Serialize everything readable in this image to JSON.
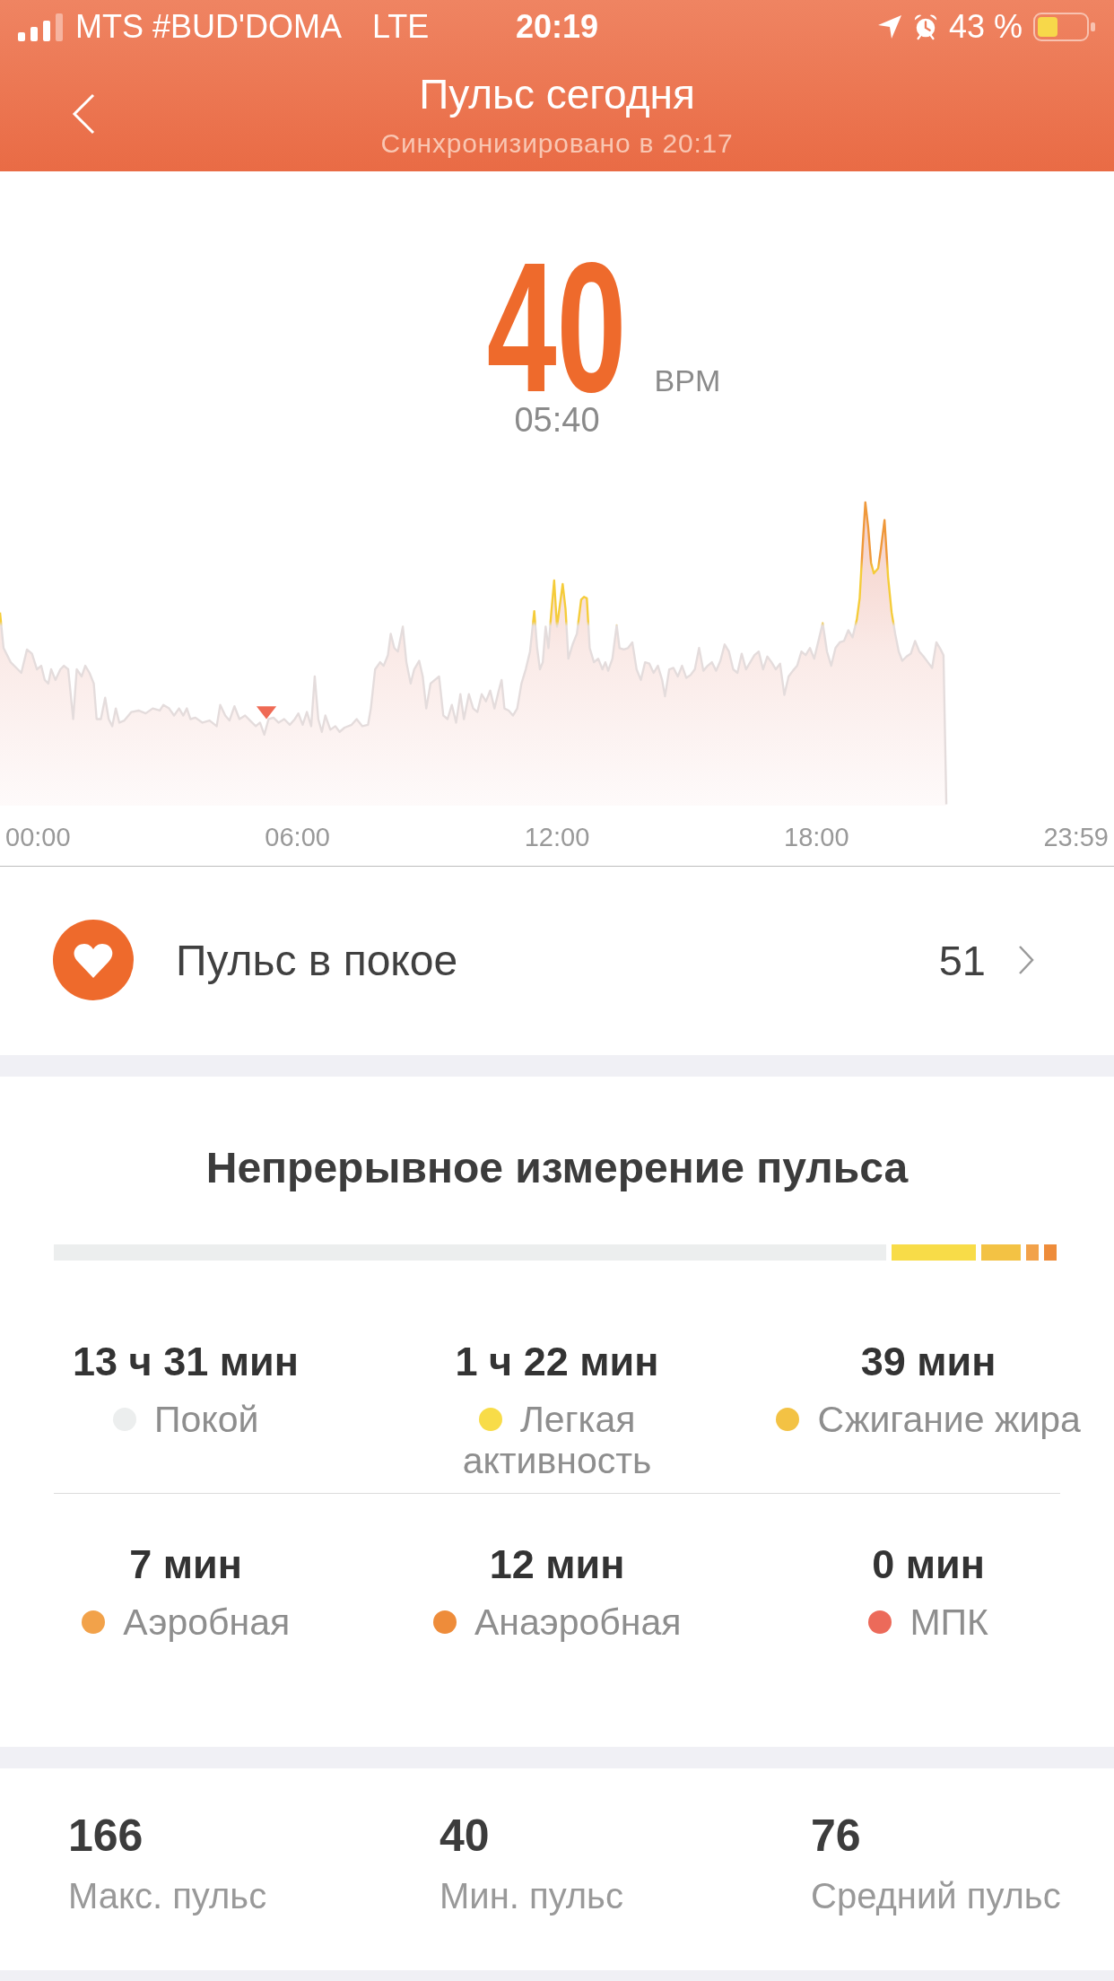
{
  "status_bar": {
    "carrier": "MTS #BUD'DOMA",
    "network": "LTE",
    "time": "20:19",
    "battery": "43 %"
  },
  "header": {
    "title": "Пульс сегодня",
    "subtitle": "Синхронизировано в 20:17"
  },
  "reading": {
    "value": "40",
    "unit": "BPM",
    "time": "05:40"
  },
  "chart": {
    "x_labels": [
      "00:00",
      "06:00",
      "12:00",
      "18:00",
      "23:59"
    ]
  },
  "resting": {
    "label": "Пульс в покое",
    "value": "51"
  },
  "zones": {
    "title": "Непрерывное измерение пульса",
    "items": [
      {
        "duration": "13 ч 31 мин",
        "label": "Покой",
        "color": "#eceeee"
      },
      {
        "duration": "1 ч 22 мин",
        "label": "Легкая активность",
        "color": "#f8dc48"
      },
      {
        "duration": "39 мин",
        "label": "Сжигание жира",
        "color": "#f3c244"
      },
      {
        "duration": "7 мин",
        "label": "Аэробная",
        "color": "#f2a24a"
      },
      {
        "duration": "12 мин",
        "label": "Анаэробная",
        "color": "#ee8c3a"
      },
      {
        "duration": "0 мин",
        "label": "МПК",
        "color": "#ec6a5a"
      }
    ]
  },
  "summary": [
    {
      "value": "166",
      "label": "Макс. пульс"
    },
    {
      "value": "40",
      "label": "Мин. пульс"
    },
    {
      "value": "76",
      "label": "Средний пульс"
    }
  ]
}
